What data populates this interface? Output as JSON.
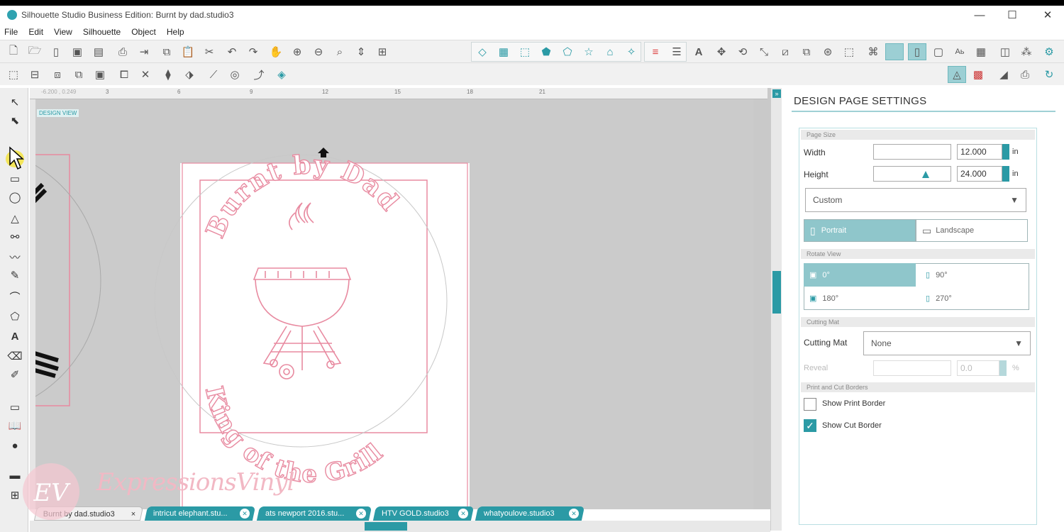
{
  "window": {
    "title": "Silhouette Studio Business Edition: Burnt by dad.studio3",
    "minimize": "—",
    "maximize": "☐",
    "close": "✕"
  },
  "menu": [
    "File",
    "Edit",
    "View",
    "Silhouette",
    "Object",
    "Help"
  ],
  "canvas": {
    "view_label": "DESIGN VIEW",
    "coords": "-6.200 , 0.249",
    "ruler_marks": [
      "3",
      "6",
      "9",
      "12",
      "15",
      "18",
      "21"
    ],
    "design_texts": {
      "top_arc": "Burnt by Dad",
      "bottom_arc": "King of the Grill"
    }
  },
  "panel": {
    "title": "DESIGN PAGE SETTINGS",
    "page_size_header": "Page Size",
    "width_label": "Width",
    "width_value": "12.000",
    "width_unit": "in",
    "height_label": "Height",
    "height_value": "24.000",
    "height_unit": "in",
    "size_preset": "Custom",
    "orientation": {
      "portrait": "Portrait",
      "landscape": "Landscape",
      "selected": "Portrait"
    },
    "rotate_header": "Rotate View",
    "rotate_options": [
      "0°",
      "90°",
      "180°",
      "270°"
    ],
    "rotate_selected": "0°",
    "cutting_mat_header": "Cutting Mat",
    "cutting_mat_label": "Cutting Mat",
    "cutting_mat_value": "None",
    "reveal_label": "Reveal",
    "reveal_value": "0.0",
    "reveal_unit": "%",
    "borders_header": "Print and Cut Borders",
    "show_print_border": "Show Print Border",
    "show_print_border_checked": false,
    "show_cut_border": "Show Cut Border",
    "show_cut_border_checked": true
  },
  "tabs": [
    {
      "label": "Burnt by dad.studio3",
      "active": true
    },
    {
      "label": "intricut elephant.stu...",
      "active": false
    },
    {
      "label": "ats newport 2016.stu...",
      "active": false
    },
    {
      "label": "HTV GOLD.studio3",
      "active": false
    },
    {
      "label": "whatyoulove.studio3",
      "active": false
    }
  ],
  "watermark": {
    "monogram": "EV",
    "text": "ExpressionsVinyl"
  },
  "colors": {
    "accent": "#2b9aa5",
    "cut_line": "#e88aa0",
    "canvas_bg": "#c9c9c9"
  }
}
